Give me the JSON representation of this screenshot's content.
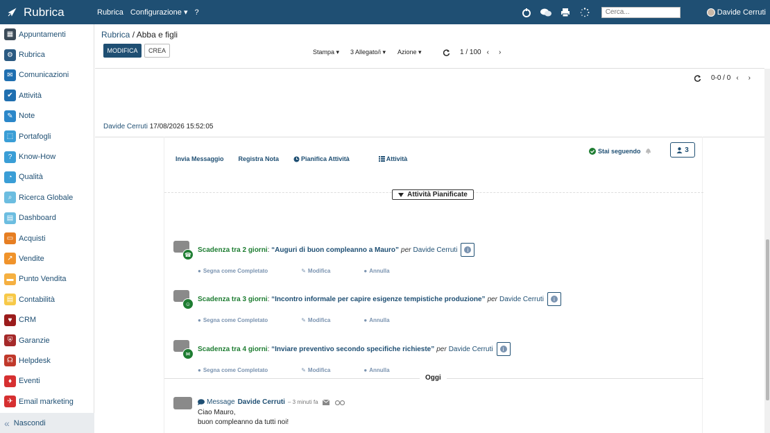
{
  "topbar": {
    "brand": "Rubrica",
    "nav": [
      "Rubrica",
      "Configurazione ▾",
      "?"
    ],
    "search_placeholder": "Cerca...",
    "user_name": "Davide Cerruti"
  },
  "sidebar": {
    "items": [
      {
        "label": "Appuntamenti",
        "color": "#3b4a58"
      },
      {
        "label": "Rubrica",
        "color": "#2a5a82"
      },
      {
        "label": "Comunicazioni",
        "color": "#1f6fb0"
      },
      {
        "label": "Attività",
        "color": "#1f6fb0"
      },
      {
        "label": "Note",
        "color": "#2b87c9"
      },
      {
        "label": "Portafogli",
        "color": "#3a9ed6"
      },
      {
        "label": "Know-How",
        "color": "#3a9ed6"
      },
      {
        "label": "Qualità",
        "color": "#3a9ed6"
      },
      {
        "label": "Ricerca Globale",
        "color": "#6cbde0"
      },
      {
        "label": "Dashboard",
        "color": "#6cbde0"
      },
      {
        "label": "Acquisti",
        "color": "#e67e22"
      },
      {
        "label": "Vendite",
        "color": "#f0932b"
      },
      {
        "label": "Punto Vendita",
        "color": "#f5b041"
      },
      {
        "label": "Contabilità",
        "color": "#f7c948"
      },
      {
        "label": "CRM",
        "color": "#9b1c1c"
      },
      {
        "label": "Garanzie",
        "color": "#a52a2a"
      },
      {
        "label": "Helpdesk",
        "color": "#c0392b"
      },
      {
        "label": "Eventi",
        "color": "#d63031"
      },
      {
        "label": "Email marketing",
        "color": "#d63031"
      }
    ],
    "footer": "Nascondi"
  },
  "record": {
    "crumb_parent": "Rubrica",
    "crumb_sep": "/",
    "crumb_current": "Abba e figli",
    "edit_label": "MODIFICA",
    "create_label": "CREA",
    "print_label": "Stampa ▾",
    "attach_label": "3 Allegato/i ▾",
    "action_label": "Azione ▾",
    "pager": "1 / 100",
    "sheet_pager": "0-0 / 0",
    "meta_user": "Davide Cerruti",
    "meta_date": "17/08/2026 15:52:05"
  },
  "chatter": {
    "send_message": "Invia Messaggio",
    "log_note": "Registra Nota",
    "schedule": "Pianifica Attività",
    "activities": "Attività",
    "following": "Stai seguendo",
    "followers_count": "3",
    "planned_title": "Attività Pianificate",
    "activities_list": [
      {
        "due": "Scadenza tra 2 giorni",
        "name": "“Auguri di buon compleanno a Mauro”",
        "per": "per",
        "user": "Davide Cerruti",
        "icon": "phone-icon"
      },
      {
        "due": "Scadenza tra 3 giorni",
        "name": "“Incontro informale per capire esigenze tempistiche produzione”",
        "per": "per",
        "user": "Davide Cerruti",
        "icon": "group-icon"
      },
      {
        "due": "Scadenza tra 4 giorni",
        "name": "“Inviare preventivo secondo specifiche richieste”",
        "per": "per",
        "user": "Davide Cerruti",
        "icon": "email-icon"
      }
    ],
    "mark_done": "Segna come Completato",
    "modify": "Modifica",
    "cancel": "Annulla",
    "today": "Oggi",
    "message": {
      "type": "Message",
      "author": "Davide Cerruti",
      "time": "– 3 minuti fa",
      "body_line1": "Ciao Mauro,",
      "body_line2": "buon compleanno da tutti noi!"
    }
  }
}
